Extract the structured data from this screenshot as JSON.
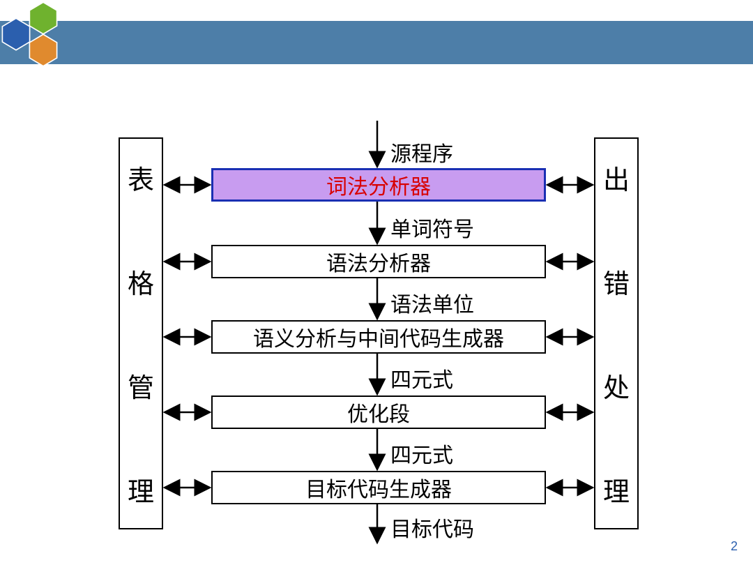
{
  "page_number": "2",
  "left_box": {
    "chars": [
      "表",
      "格",
      "管",
      "理"
    ]
  },
  "right_box": {
    "chars": [
      "出",
      "错",
      "处",
      "理"
    ]
  },
  "nodes": {
    "highlight": "词法分析器",
    "parser": "语法分析器",
    "semantic": "语义分析与中间代码生成器",
    "optimize": "优化段",
    "codegen": "目标代码生成器"
  },
  "edges": {
    "src": "源程序",
    "token": "单词符号",
    "unit": "语法单位",
    "quad1": "四元式",
    "quad2": "四元式",
    "target": "目标代码"
  }
}
